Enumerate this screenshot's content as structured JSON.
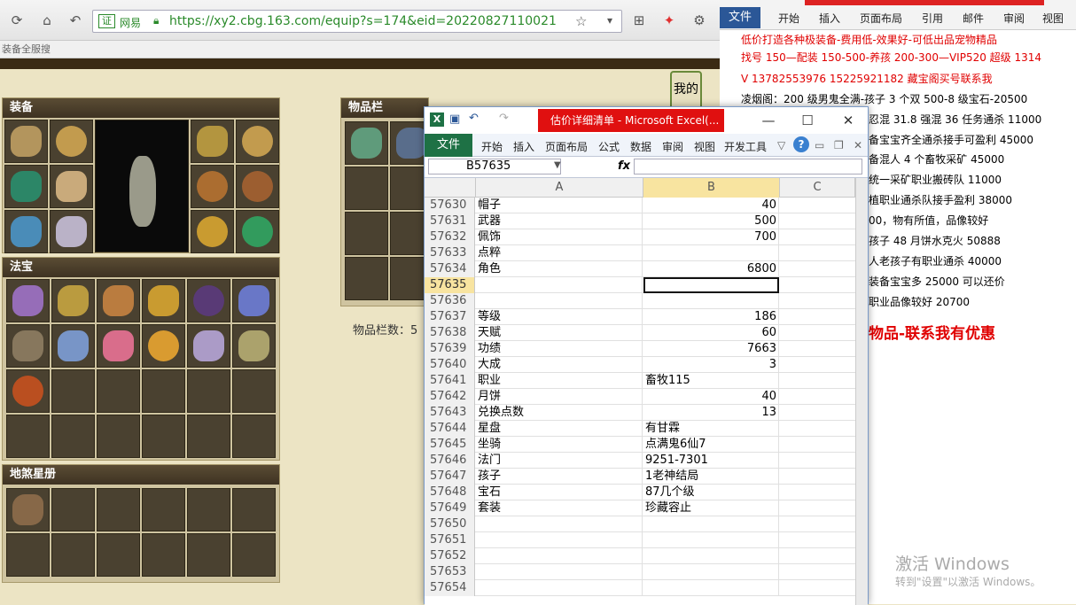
{
  "browser": {
    "url": "https://xy2.cbg.163.com/equip?s=174&eid=20220827110021",
    "cert_badge": "证",
    "cert_label": "网易",
    "bookmark_text": "装备全服搜"
  },
  "game": {
    "panel_equipment": "装备",
    "panel_inventory": "物品栏",
    "panel_treasure": "法宝",
    "panel_star_book": "地煞星册",
    "items_count_label": "物品栏数：5",
    "side_button": "我的"
  },
  "word": {
    "tabs": [
      "文件",
      "开始",
      "插入",
      "页面布局",
      "引用",
      "邮件",
      "审阅",
      "视图"
    ],
    "lines": [
      {
        "text": "低价打造各种极装备-费用低-效果好-可低出品宠物精品",
        "red": true
      },
      {
        "text": "找号 150—配装 150-500-养孩 200-300—VIP520 超级 1314",
        "red": true
      },
      {
        "text": "V 13782553976    15225921182   藏宝阁买号联系我",
        "red": true
      },
      {
        "text": "凌烟阁：200 级男鬼全满-孩子 3 个双 500-8 级宝石-20500",
        "red": false
      },
      {
        "text": "忍混 31.8 强混 36 任务通杀 11000",
        "red": false
      },
      {
        "text": "备宝宝齐全通杀接手可盈利 45000",
        "red": false
      },
      {
        "text": "备混人 4 个畜牧采矿 45000",
        "red": false
      },
      {
        "text": "统一采矿职业搬砖队 11000",
        "red": false
      },
      {
        "text": "植职业通杀队接手盈利 38000",
        "red": false
      },
      {
        "text": "00，物有所值，品像较好",
        "red": false
      },
      {
        "text": "孩子 48 月饼水克火 50888",
        "red": false
      },
      {
        "text": "人老孩子有职业通杀 40000",
        "red": false
      },
      {
        "text": "装备宝宝多 25000 可以还价",
        "red": false
      },
      {
        "text": "职业品像较好 20700",
        "red": false
      },
      {
        "text": "物品-联系我有优惠",
        "red": true
      }
    ],
    "activate_title": "激活 Windows",
    "activate_hint": "转到\"设置\"以激活 Windows。"
  },
  "excel": {
    "title": "估价详细清单 - Microsoft Excel(...",
    "tabs": [
      "文件",
      "开始",
      "插入",
      "页面布局",
      "公式",
      "数据",
      "审阅",
      "视图",
      "开发工具"
    ],
    "name_box": "B57635",
    "formula": "",
    "columns": [
      "A",
      "B",
      "C"
    ],
    "rows": [
      {
        "n": "57630",
        "a": "帽子",
        "b": "40",
        "num": true
      },
      {
        "n": "57631",
        "a": "武器",
        "b": "500",
        "num": true
      },
      {
        "n": "57632",
        "a": "佩饰",
        "b": "700",
        "num": true
      },
      {
        "n": "57633",
        "a": "点粹",
        "b": "",
        "num": true
      },
      {
        "n": "57634",
        "a": "角色",
        "b": "6800",
        "num": true
      },
      {
        "n": "57635",
        "a": "",
        "b": "",
        "num": true,
        "selected": true
      },
      {
        "n": "57636",
        "a": "",
        "b": "",
        "num": true
      },
      {
        "n": "57637",
        "a": "等级",
        "b": "186",
        "num": true
      },
      {
        "n": "57638",
        "a": "天赋",
        "b": "60",
        "num": true
      },
      {
        "n": "57639",
        "a": "功绩",
        "b": "7663",
        "num": true
      },
      {
        "n": "57640",
        "a": "大成",
        "b": "3",
        "num": true
      },
      {
        "n": "57641",
        "a": "职业",
        "b": "畜牧115",
        "num": false
      },
      {
        "n": "57642",
        "a": "月饼",
        "b": "40",
        "num": true
      },
      {
        "n": "57643",
        "a": "兑换点数",
        "b": "13",
        "num": true
      },
      {
        "n": "57644",
        "a": "星盘",
        "b": "有甘霖",
        "num": false
      },
      {
        "n": "57645",
        "a": "坐骑",
        "b": "点满鬼6仙7",
        "num": false
      },
      {
        "n": "57646",
        "a": "法门",
        "b": "9251-7301",
        "num": false
      },
      {
        "n": "57647",
        "a": "孩子",
        "b": "1老神结局",
        "num": false
      },
      {
        "n": "57648",
        "a": "宝石",
        "b": "87几个级",
        "num": false
      },
      {
        "n": "57649",
        "a": "套装",
        "b": "珍藏容止",
        "num": false
      },
      {
        "n": "57650",
        "a": "",
        "b": "",
        "num": true
      },
      {
        "n": "57651",
        "a": "",
        "b": "",
        "num": true
      },
      {
        "n": "57652",
        "a": "",
        "b": "",
        "num": true
      },
      {
        "n": "57653",
        "a": "",
        "b": "",
        "num": true
      },
      {
        "n": "57654",
        "a": "",
        "b": "",
        "num": true
      }
    ]
  }
}
